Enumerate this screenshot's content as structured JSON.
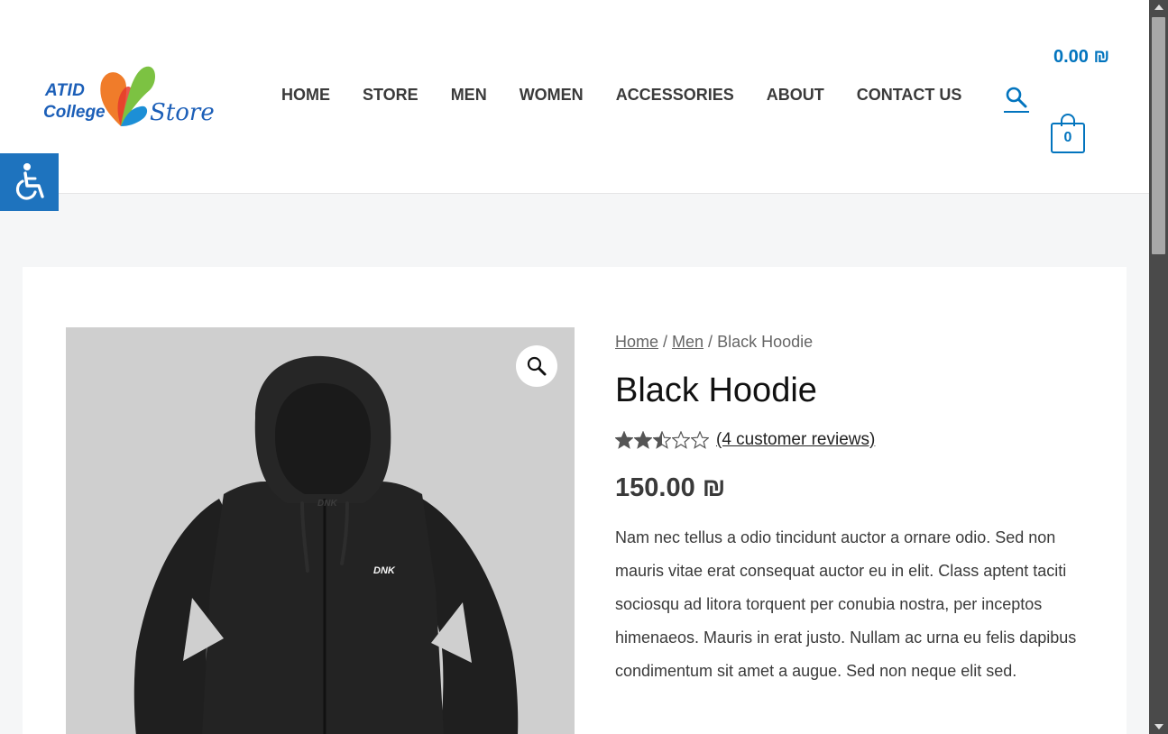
{
  "header": {
    "logo": {
      "line1": "ATID",
      "line2": "College",
      "line3": "Store"
    },
    "nav": [
      "HOME",
      "STORE",
      "MEN",
      "WOMEN",
      "ACCESSORIES",
      "ABOUT",
      "CONTACT US"
    ],
    "cart_total": "0.00 ₪",
    "cart_count": "0",
    "accent_color": "#0274be"
  },
  "accessibility": {
    "icon": "wheelchair-icon",
    "color": "#1e73be"
  },
  "product": {
    "breadcrumb": {
      "home": "Home",
      "sep1": " / ",
      "category": "Men",
      "sep2": " / ",
      "current": "Black Hoodie"
    },
    "title": "Black Hoodie",
    "rating": {
      "value": 2.5,
      "max": 5
    },
    "reviews_link": "(4 customer reviews)",
    "price": "150.00 ₪",
    "description": "Nam nec tellus a odio tincidunt auctor a ornare odio. Sed non mauris vitae erat consequat auctor eu in elit. Class aptent taciti sociosqu ad litora torquent per conubia nostra, per inceptos himenaeos. Mauris in erat justo. Nullam ac urna eu felis dapibus condimentum sit amet a augue. Sed non neque elit sed.",
    "image": {
      "chest_print": "DNK",
      "hood_print": "DNK",
      "zoom_icon": "magnifier-icon"
    }
  }
}
